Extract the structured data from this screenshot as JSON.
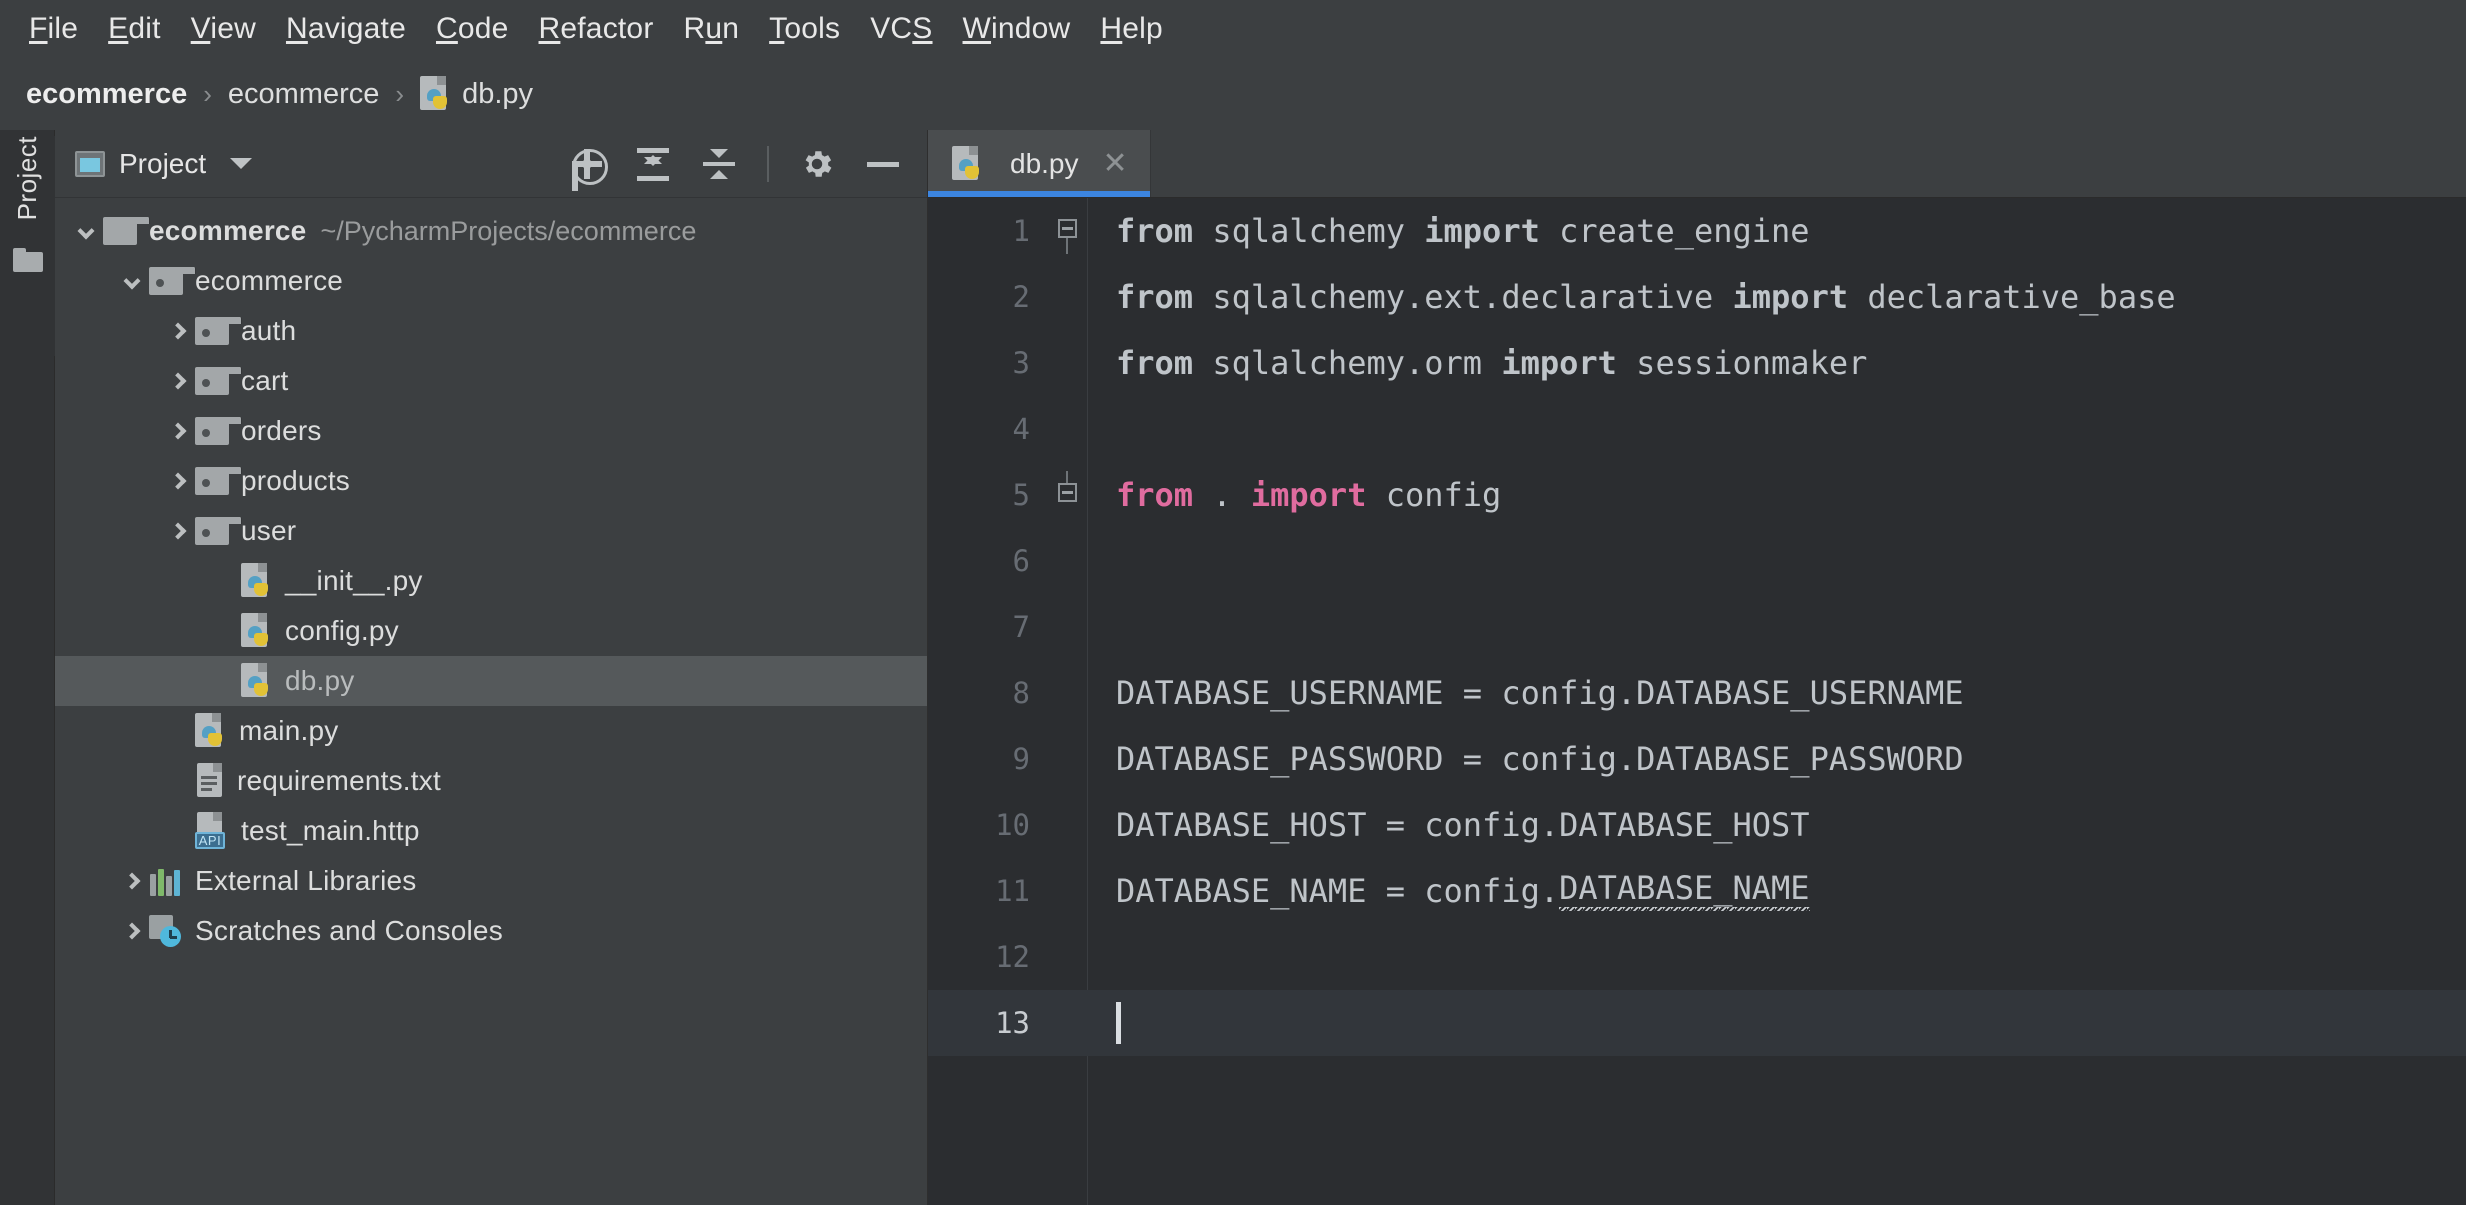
{
  "menubar": {
    "items": [
      {
        "label": "File",
        "mnemonic": "F"
      },
      {
        "label": "Edit",
        "mnemonic": "E"
      },
      {
        "label": "View",
        "mnemonic": "V"
      },
      {
        "label": "Navigate",
        "mnemonic": "N"
      },
      {
        "label": "Code",
        "mnemonic": "C"
      },
      {
        "label": "Refactor",
        "mnemonic": "R"
      },
      {
        "label": "Run",
        "mnemonic": "u"
      },
      {
        "label": "Tools",
        "mnemonic": "T"
      },
      {
        "label": "VCS",
        "mnemonic": "S"
      },
      {
        "label": "Window",
        "mnemonic": "W"
      },
      {
        "label": "Help",
        "mnemonic": "H"
      }
    ]
  },
  "breadcrumb": {
    "separator": "›",
    "items": [
      {
        "label": "ecommerce",
        "icon": "none",
        "bold": true
      },
      {
        "label": "ecommerce",
        "icon": "none",
        "bold": false
      },
      {
        "label": "db.py",
        "icon": "python-file-icon",
        "bold": false
      }
    ]
  },
  "toolstrip": {
    "project_tab_label": "Project",
    "project_tab_icon": "folder-icon"
  },
  "project_panel": {
    "title": "Project",
    "title_icon": "project-view-icon",
    "dropdown_icon": "chevron-down-icon",
    "actions": [
      {
        "name": "select-opened-file-button",
        "icon": "target-icon"
      },
      {
        "name": "expand-all-button",
        "icon": "expand-all-icon"
      },
      {
        "name": "collapse-all-button",
        "icon": "collapse-all-icon"
      },
      {
        "name": "settings-button",
        "icon": "gear-icon"
      },
      {
        "name": "hide-button",
        "icon": "minus-icon"
      }
    ],
    "tree": [
      {
        "label": "ecommerce",
        "path": "~/PycharmProjects/ecommerce",
        "icon": "folder-icon",
        "arrow": "down",
        "indent": 0,
        "bold": true,
        "selected": false
      },
      {
        "label": "ecommerce",
        "path": "",
        "icon": "package-folder-icon",
        "arrow": "down",
        "indent": 1,
        "bold": false,
        "selected": false
      },
      {
        "label": "auth",
        "path": "",
        "icon": "package-folder-icon",
        "arrow": "right",
        "indent": 2,
        "bold": false,
        "selected": false
      },
      {
        "label": "cart",
        "path": "",
        "icon": "package-folder-icon",
        "arrow": "right",
        "indent": 2,
        "bold": false,
        "selected": false
      },
      {
        "label": "orders",
        "path": "",
        "icon": "package-folder-icon",
        "arrow": "right",
        "indent": 2,
        "bold": false,
        "selected": false
      },
      {
        "label": "products",
        "path": "",
        "icon": "package-folder-icon",
        "arrow": "right",
        "indent": 2,
        "bold": false,
        "selected": false
      },
      {
        "label": "user",
        "path": "",
        "icon": "package-folder-icon",
        "arrow": "right",
        "indent": 2,
        "bold": false,
        "selected": false
      },
      {
        "label": "__init__.py",
        "path": "",
        "icon": "python-file-icon",
        "arrow": "blank",
        "indent": 3,
        "bold": false,
        "selected": false
      },
      {
        "label": "config.py",
        "path": "",
        "icon": "python-file-icon",
        "arrow": "blank",
        "indent": 3,
        "bold": false,
        "selected": false
      },
      {
        "label": "db.py",
        "path": "",
        "icon": "python-file-icon",
        "arrow": "blank",
        "indent": 3,
        "bold": false,
        "selected": true
      },
      {
        "label": "main.py",
        "path": "",
        "icon": "python-file-icon",
        "arrow": "blank",
        "indent": 2,
        "bold": false,
        "selected": false
      },
      {
        "label": "requirements.txt",
        "path": "",
        "icon": "text-file-icon",
        "arrow": "blank",
        "indent": 2,
        "bold": false,
        "selected": false
      },
      {
        "label": "test_main.http",
        "path": "",
        "icon": "http-file-icon",
        "arrow": "blank",
        "indent": 2,
        "bold": false,
        "selected": false
      },
      {
        "label": "External Libraries",
        "path": "",
        "icon": "libraries-icon",
        "arrow": "right",
        "indent": 1,
        "bold": false,
        "selected": false
      },
      {
        "label": "Scratches and Consoles",
        "path": "",
        "icon": "scratches-icon",
        "arrow": "right",
        "indent": 1,
        "bold": false,
        "selected": false
      }
    ]
  },
  "editor": {
    "tabs": [
      {
        "label": "db.py",
        "icon": "python-file-icon",
        "active": true,
        "close_icon": "close-icon"
      }
    ],
    "close_glyph": "✕",
    "current_line": 13,
    "lines": [
      {
        "num": 1,
        "fold": "collapse-start",
        "tokens": [
          {
            "t": "from",
            "c": "kw"
          },
          {
            "t": " sqlalchemy ",
            "c": "plain"
          },
          {
            "t": "import",
            "c": "kw"
          },
          {
            "t": " create_engine",
            "c": "plain"
          }
        ]
      },
      {
        "num": 2,
        "fold": "",
        "tokens": [
          {
            "t": "from",
            "c": "kw"
          },
          {
            "t": " sqlalchemy.ext.declarative ",
            "c": "plain"
          },
          {
            "t": "import",
            "c": "kw"
          },
          {
            "t": " declarative_base",
            "c": "plain"
          }
        ]
      },
      {
        "num": 3,
        "fold": "",
        "tokens": [
          {
            "t": "from",
            "c": "kw"
          },
          {
            "t": " sqlalchemy.orm ",
            "c": "plain"
          },
          {
            "t": "import",
            "c": "kw"
          },
          {
            "t": " sessionmaker",
            "c": "plain"
          }
        ]
      },
      {
        "num": 4,
        "fold": "",
        "tokens": []
      },
      {
        "num": 5,
        "fold": "collapse-end",
        "tokens": [
          {
            "t": "from",
            "c": "kw-pink"
          },
          {
            "t": " . ",
            "c": "plain"
          },
          {
            "t": "import",
            "c": "kw-pink"
          },
          {
            "t": " config",
            "c": "plain"
          }
        ]
      },
      {
        "num": 6,
        "fold": "",
        "tokens": []
      },
      {
        "num": 7,
        "fold": "",
        "tokens": []
      },
      {
        "num": 8,
        "fold": "",
        "tokens": [
          {
            "t": "DATABASE_USERNAME = config.DATABASE_USERNAME",
            "c": "plain"
          }
        ]
      },
      {
        "num": 9,
        "fold": "",
        "tokens": [
          {
            "t": "DATABASE_PASSWORD = config.DATABASE_PASSWORD",
            "c": "plain"
          }
        ]
      },
      {
        "num": 10,
        "fold": "",
        "tokens": [
          {
            "t": "DATABASE_HOST = config.DATABASE_HOST",
            "c": "plain"
          }
        ]
      },
      {
        "num": 11,
        "fold": "",
        "tokens": [
          {
            "t": "DATABASE_NAME = config.",
            "c": "plain"
          },
          {
            "t": "DATABASE_NAME",
            "c": "warnsq"
          }
        ]
      },
      {
        "num": 12,
        "fold": "",
        "tokens": []
      },
      {
        "num": 13,
        "fold": "",
        "tokens": [],
        "caret": true
      }
    ]
  },
  "colors": {
    "chrome_bg": "#3C3F41",
    "editor_bg": "#2B2D30",
    "selection_bg": "#55595B",
    "current_line_bg": "#32363B",
    "tab_accent": "#3C85E0",
    "keyword_pink": "#E06C9F",
    "text_primary": "#BFC4C9",
    "line_number": "#676C73"
  }
}
